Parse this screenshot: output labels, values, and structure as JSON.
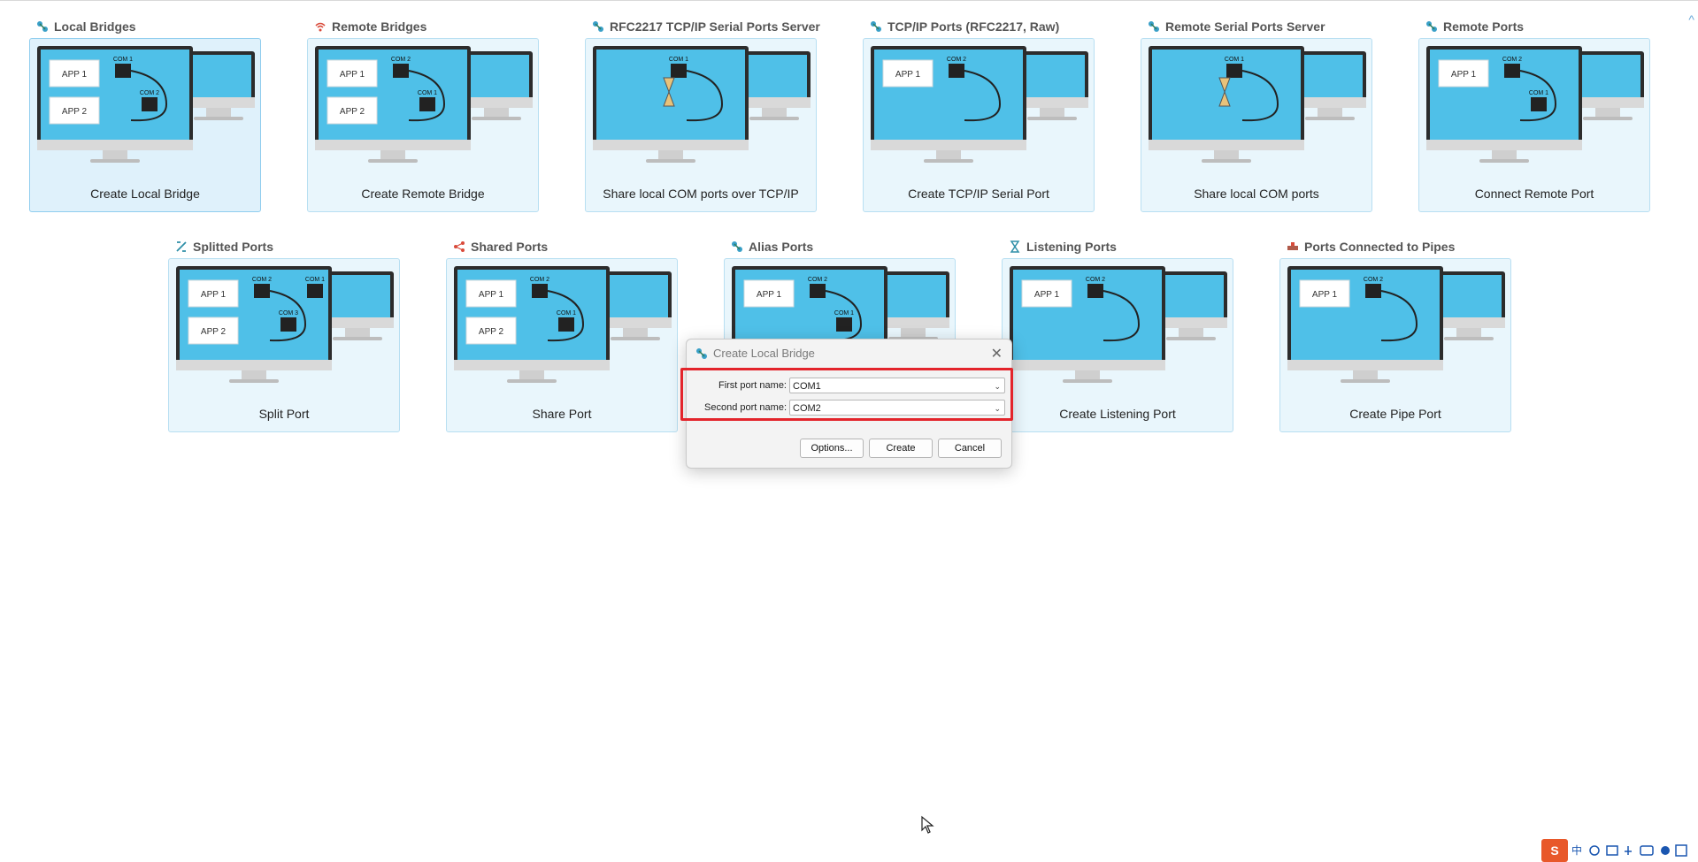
{
  "colors": {
    "accent": "#e3242b",
    "screen": "#4fc0e8",
    "card_bg": "#e9f6fc",
    "card_border": "#b8dff2"
  },
  "tiles_row1": [
    {
      "header": "Local Bridges",
      "caption": "Create Local Bridge",
      "icon": "bridge-icon",
      "selected": true,
      "apps": [
        "APP 1",
        "APP 2"
      ],
      "ports": [
        "COM 1",
        "COM 2"
      ]
    },
    {
      "header": "Remote Bridges",
      "caption": "Create Remote Bridge",
      "icon": "wifi-icon",
      "apps": [
        "APP 1",
        "APP 2"
      ],
      "ports": [
        "COM 2",
        "COM 1"
      ]
    },
    {
      "header": "RFC2217 TCP/IP Serial Ports Server",
      "caption": "Share local COM ports over TCP/IP",
      "icon": "server-icon",
      "apps": [],
      "ports": [
        "COM 1"
      ]
    },
    {
      "header": "TCP/IP Ports (RFC2217, Raw)",
      "caption": "Create TCP/IP Serial Port",
      "icon": "network-port-icon",
      "apps": [
        "APP 1"
      ],
      "ports": [
        "COM 2"
      ]
    },
    {
      "header": "Remote Serial Ports Server",
      "caption": "Share local COM ports",
      "icon": "remote-server-icon",
      "apps": [],
      "ports": [
        "COM 1"
      ]
    },
    {
      "header": "Remote Ports",
      "caption": "Connect Remote Port",
      "icon": "remote-port-icon",
      "apps": [
        "APP 1"
      ],
      "ports": [
        "COM 2",
        "COM 1"
      ]
    }
  ],
  "tiles_row2": [
    {
      "header": "Splitted Ports",
      "caption": "Split Port",
      "icon": "split-icon",
      "apps": [
        "APP 1",
        "APP 2"
      ],
      "ports": [
        "COM 2",
        "COM 3",
        "COM 1"
      ]
    },
    {
      "header": "Shared Ports",
      "caption": "Share Port",
      "icon": "share-icon",
      "apps": [
        "APP 1",
        "APP 2"
      ],
      "ports": [
        "COM 2",
        "COM 1"
      ]
    },
    {
      "header": "Alias Ports",
      "caption": "",
      "icon": "alias-icon",
      "apps": [
        "APP 1"
      ],
      "ports": [
        "COM 2",
        "COM 1"
      ]
    },
    {
      "header": "Listening Ports",
      "caption": "Create Listening Port",
      "icon": "hourglass-icon",
      "apps": [
        "APP 1"
      ],
      "ports": [
        "COM 2"
      ]
    },
    {
      "header": "Ports Connected to Pipes",
      "caption": "Create Pipe Port",
      "icon": "pipe-icon",
      "apps": [
        "APP 1"
      ],
      "ports": [
        "COM 2"
      ]
    }
  ],
  "dialog": {
    "title": "Create Local Bridge",
    "first_label": "First port name:",
    "first_value": "COM1",
    "second_label": "Second port name:",
    "second_value": "COM2",
    "options_label": "Options...",
    "create_label": "Create",
    "cancel_label": "Cancel"
  },
  "tray": {
    "text": "中"
  }
}
